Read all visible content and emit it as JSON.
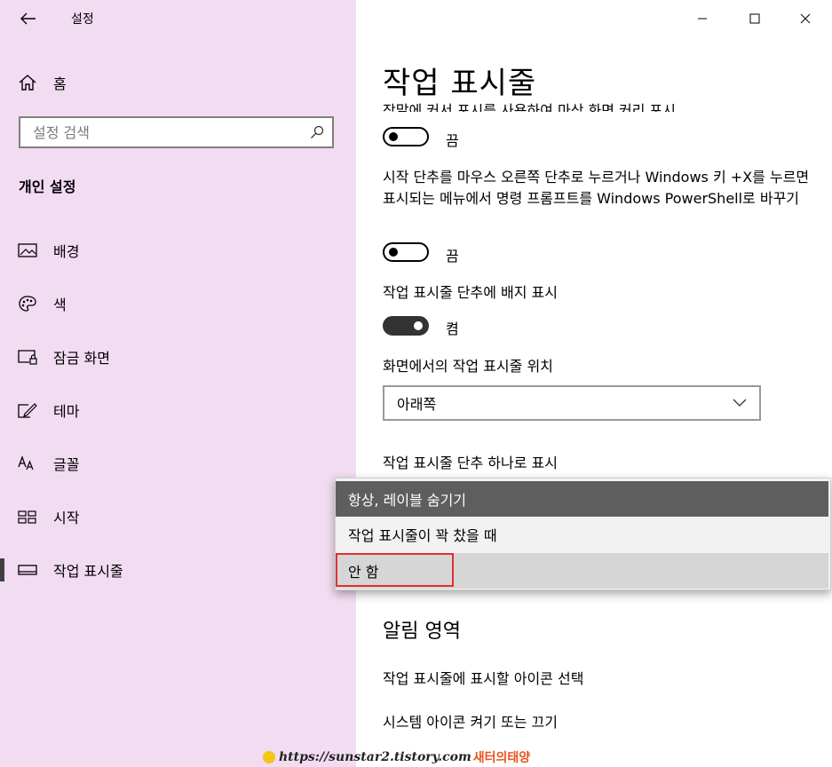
{
  "window": {
    "title": "설정"
  },
  "sidebar": {
    "home_label": "홈",
    "search_placeholder": "설정 검색",
    "section_title": "개인 설정",
    "items": [
      {
        "label": "배경",
        "icon": "picture-icon"
      },
      {
        "label": "색",
        "icon": "palette-icon"
      },
      {
        "label": "잠금 화면",
        "icon": "lock-screen-icon"
      },
      {
        "label": "테마",
        "icon": "theme-icon"
      },
      {
        "label": "글꼴",
        "icon": "font-icon"
      },
      {
        "label": "시작",
        "icon": "start-icon"
      },
      {
        "label": "작업 표시줄",
        "icon": "taskbar-icon",
        "active": true
      }
    ]
  },
  "main": {
    "page_title": "작업 표시줄",
    "clipped_text": "장말에 커서 포시를 사용하여 마상 화면 커리 포시",
    "toggle1": {
      "state_label": "끔",
      "on": false
    },
    "setting2_text": "시작 단추를 마우스 오른쪽 단추로 누르거나 Windows 키 +X를 누르면 표시되는 메뉴에서 명령 프롬프트를 Windows PowerShell로 바꾸기",
    "toggle2": {
      "state_label": "끔",
      "on": false
    },
    "setting3_text": "작업 표시줄 단추에 배지 표시",
    "toggle3": {
      "state_label": "켬",
      "on": true
    },
    "position_label": "화면에서의 작업 표시줄 위치",
    "position_value": "아래쪽",
    "combine_label": "작업 표시줄 단추 하나로 표시",
    "combine_options": [
      "항상, 레이블 숨기기",
      "작업 표시줄이 꽉 찼을 때",
      "안 함"
    ],
    "notification_title": "알림 영역",
    "links": [
      "작업 표시줄에 표시할 아이콘 선택",
      "시스템 아이콘 켜기 또는 끄기"
    ]
  },
  "watermark": {
    "url": "https://sunstar2.tistory.com",
    "name": "새터의태양"
  },
  "colors": {
    "sidebar_bg": "#f2dcf1",
    "selected_option_bg": "#5e5e5e",
    "highlight_box": "#e03131",
    "toggle_on": "#333333"
  }
}
